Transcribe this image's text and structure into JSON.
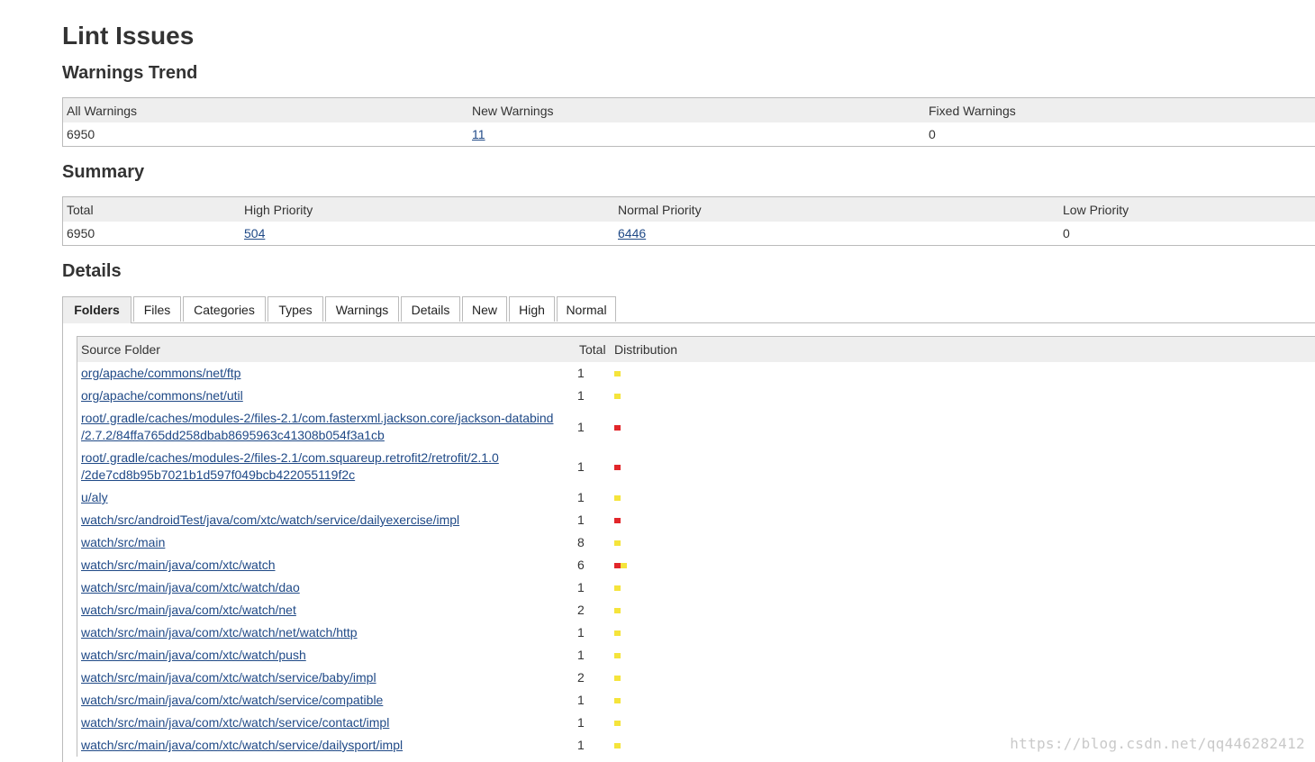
{
  "page": {
    "title": "Lint Issues"
  },
  "trend": {
    "heading": "Warnings Trend",
    "headers": [
      "All Warnings",
      "New Warnings",
      "Fixed Warnings"
    ],
    "values": {
      "all": "6950",
      "new": "11",
      "fixed": "0"
    }
  },
  "summary": {
    "heading": "Summary",
    "headers": [
      "Total",
      "High Priority",
      "Normal Priority",
      "Low Priority"
    ],
    "values": {
      "total": "6950",
      "high": "504",
      "normal": "6446",
      "low": "0"
    }
  },
  "details": {
    "heading": "Details",
    "tabs": [
      "Folders",
      "Files",
      "Categories",
      "Types",
      "Warnings",
      "Details",
      "New",
      "High",
      "Normal"
    ],
    "active_tab": "Folders",
    "columns": [
      "Source Folder",
      "Total",
      "Distribution"
    ],
    "rows": [
      {
        "folder": [
          "org/apache/commons/net/ftp"
        ],
        "total": "1",
        "dist": [
          "normal"
        ]
      },
      {
        "folder": [
          "org/apache/commons/net/util"
        ],
        "total": "1",
        "dist": [
          "normal"
        ]
      },
      {
        "folder": [
          "root/.gradle/caches/modules-2/files-2.1/com.fasterxml.jackson.core/jackson-databind",
          "/2.7.2/84ffa765dd258dbab8695963c41308b054f3a1cb"
        ],
        "total": "1",
        "dist": [
          "high"
        ]
      },
      {
        "folder": [
          "root/.gradle/caches/modules-2/files-2.1/com.squareup.retrofit2/retrofit/2.1.0",
          "/2de7cd8b95b7021b1d597f049bcb422055119f2c"
        ],
        "total": "1",
        "dist": [
          "high"
        ]
      },
      {
        "folder": [
          "u/aly"
        ],
        "total": "1",
        "dist": [
          "normal"
        ]
      },
      {
        "folder": [
          "watch/src/androidTest/java/com/xtc/watch/service/dailyexercise/impl"
        ],
        "total": "1",
        "dist": [
          "high"
        ]
      },
      {
        "folder": [
          "watch/src/main"
        ],
        "total": "8",
        "dist": [
          "normal"
        ]
      },
      {
        "folder": [
          "watch/src/main/java/com/xtc/watch"
        ],
        "total": "6",
        "dist": [
          "high",
          "normal"
        ]
      },
      {
        "folder": [
          "watch/src/main/java/com/xtc/watch/dao"
        ],
        "total": "1",
        "dist": [
          "normal"
        ]
      },
      {
        "folder": [
          "watch/src/main/java/com/xtc/watch/net"
        ],
        "total": "2",
        "dist": [
          "normal"
        ]
      },
      {
        "folder": [
          "watch/src/main/java/com/xtc/watch/net/watch/http"
        ],
        "total": "1",
        "dist": [
          "normal"
        ]
      },
      {
        "folder": [
          "watch/src/main/java/com/xtc/watch/push"
        ],
        "total": "1",
        "dist": [
          "normal"
        ]
      },
      {
        "folder": [
          "watch/src/main/java/com/xtc/watch/service/baby/impl"
        ],
        "total": "2",
        "dist": [
          "normal"
        ]
      },
      {
        "folder": [
          "watch/src/main/java/com/xtc/watch/service/compatible"
        ],
        "total": "1",
        "dist": [
          "normal"
        ]
      },
      {
        "folder": [
          "watch/src/main/java/com/xtc/watch/service/contact/impl"
        ],
        "total": "1",
        "dist": [
          "normal"
        ]
      },
      {
        "folder": [
          "watch/src/main/java/com/xtc/watch/service/dailysport/impl"
        ],
        "total": "1",
        "dist": [
          "normal"
        ]
      }
    ]
  },
  "colors": {
    "high": "#e2262a",
    "normal": "#f5e43b",
    "link": "#204a87",
    "header_bg": "#eeeeee"
  },
  "watermark": "https://blog.csdn.net/qq446282412"
}
